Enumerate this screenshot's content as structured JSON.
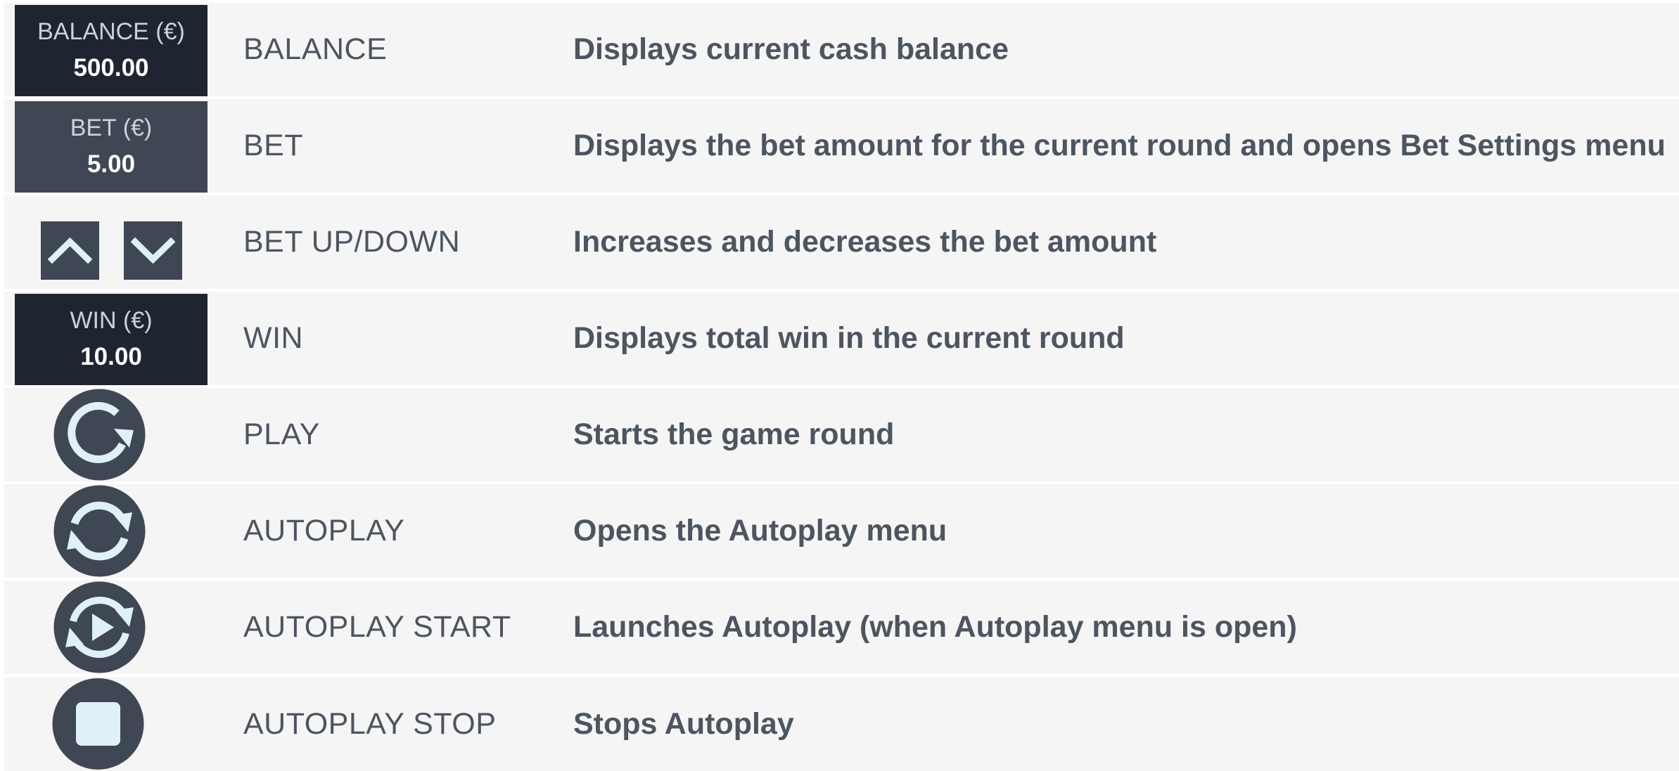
{
  "rows": [
    {
      "display_label": "BALANCE (€)",
      "display_value": "500.00",
      "name": "BALANCE",
      "description": "Displays current cash balance"
    },
    {
      "display_label": "BET (€)",
      "display_value": "5.00",
      "name": "BET",
      "description": "Displays the bet amount for the current round and opens Bet Settings menu"
    },
    {
      "icons": [
        "chevron-up-icon",
        "chevron-down-icon"
      ],
      "name": "BET UP/DOWN",
      "description": "Increases and decreases the bet amount"
    },
    {
      "display_label": "WIN (€)",
      "display_value": "10.00",
      "name": "WIN",
      "description": "Displays total win in the current round"
    },
    {
      "icon": "play-spin-icon",
      "name": "PLAY",
      "description": "Starts the game round"
    },
    {
      "icon": "autoplay-icon",
      "name": "AUTOPLAY",
      "description": "Opens the Autoplay menu"
    },
    {
      "icon": "autoplay-start-icon",
      "name": "AUTOPLAY START",
      "description": "Launches Autoplay (when Autoplay menu is open)"
    },
    {
      "icon": "autoplay-stop-icon",
      "name": "AUTOPLAY STOP",
      "description": "Stops Autoplay"
    }
  ],
  "colors": {
    "row_background": "#f5f5f6",
    "display_dark": "#1f2530",
    "display_slate": "#3e4753",
    "button_fill": "#3e4753",
    "icon_glyph": "#dff0f8",
    "text": "#4c5560"
  }
}
